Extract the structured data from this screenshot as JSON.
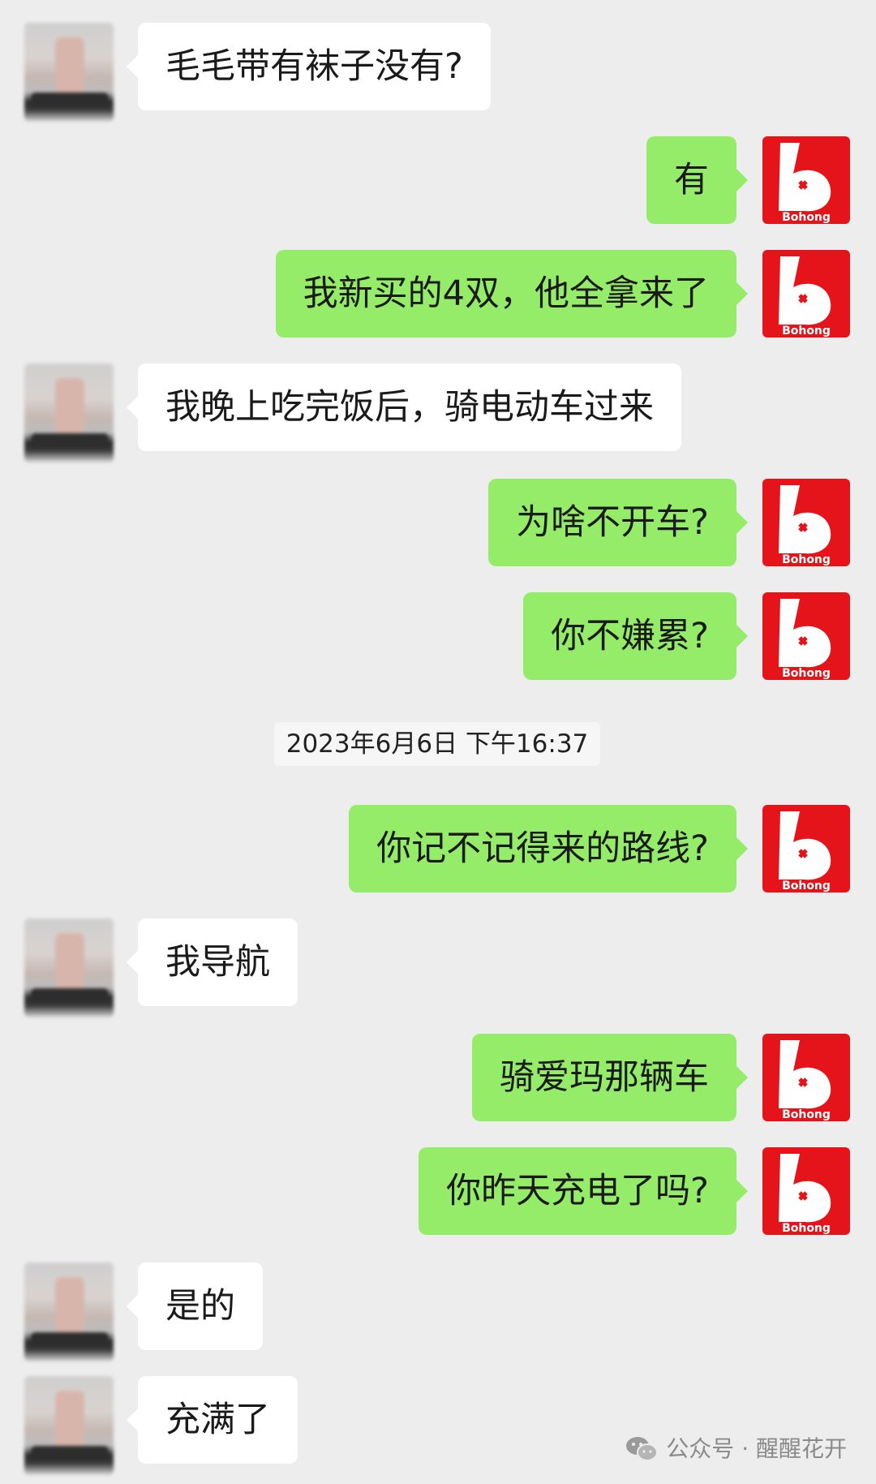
{
  "messages": [
    {
      "side": "in",
      "text": "毛毛带有袜子没有?"
    },
    {
      "side": "out",
      "text": "有"
    },
    {
      "side": "out",
      "text": "我新买的4双，他全拿来了"
    },
    {
      "side": "in",
      "text": "我晚上吃完饭后，骑电动车过来"
    },
    {
      "side": "out",
      "text": "为啥不开车?"
    },
    {
      "side": "out",
      "text": "你不嫌累?"
    },
    {
      "side": "out",
      "text": "你记不记得来的路线?"
    },
    {
      "side": "in",
      "text": "我导航"
    },
    {
      "side": "out",
      "text": "骑爱玛那辆车"
    },
    {
      "side": "out",
      "text": "你昨天充电了吗?"
    },
    {
      "side": "in",
      "text": "是的"
    },
    {
      "side": "in",
      "text": "充满了"
    }
  ],
  "timestamp": "2023年6月6日 下午16:37",
  "avatar_logo_text": "Bohong",
  "watermark": {
    "icon": "wechat-icon",
    "text": "公众号 · 醒醒花开"
  },
  "colors": {
    "sent_bubble": "#95ec69",
    "received_bubble": "#ffffff",
    "background": "#ededed",
    "avatar_brand": "#e5141b"
  }
}
